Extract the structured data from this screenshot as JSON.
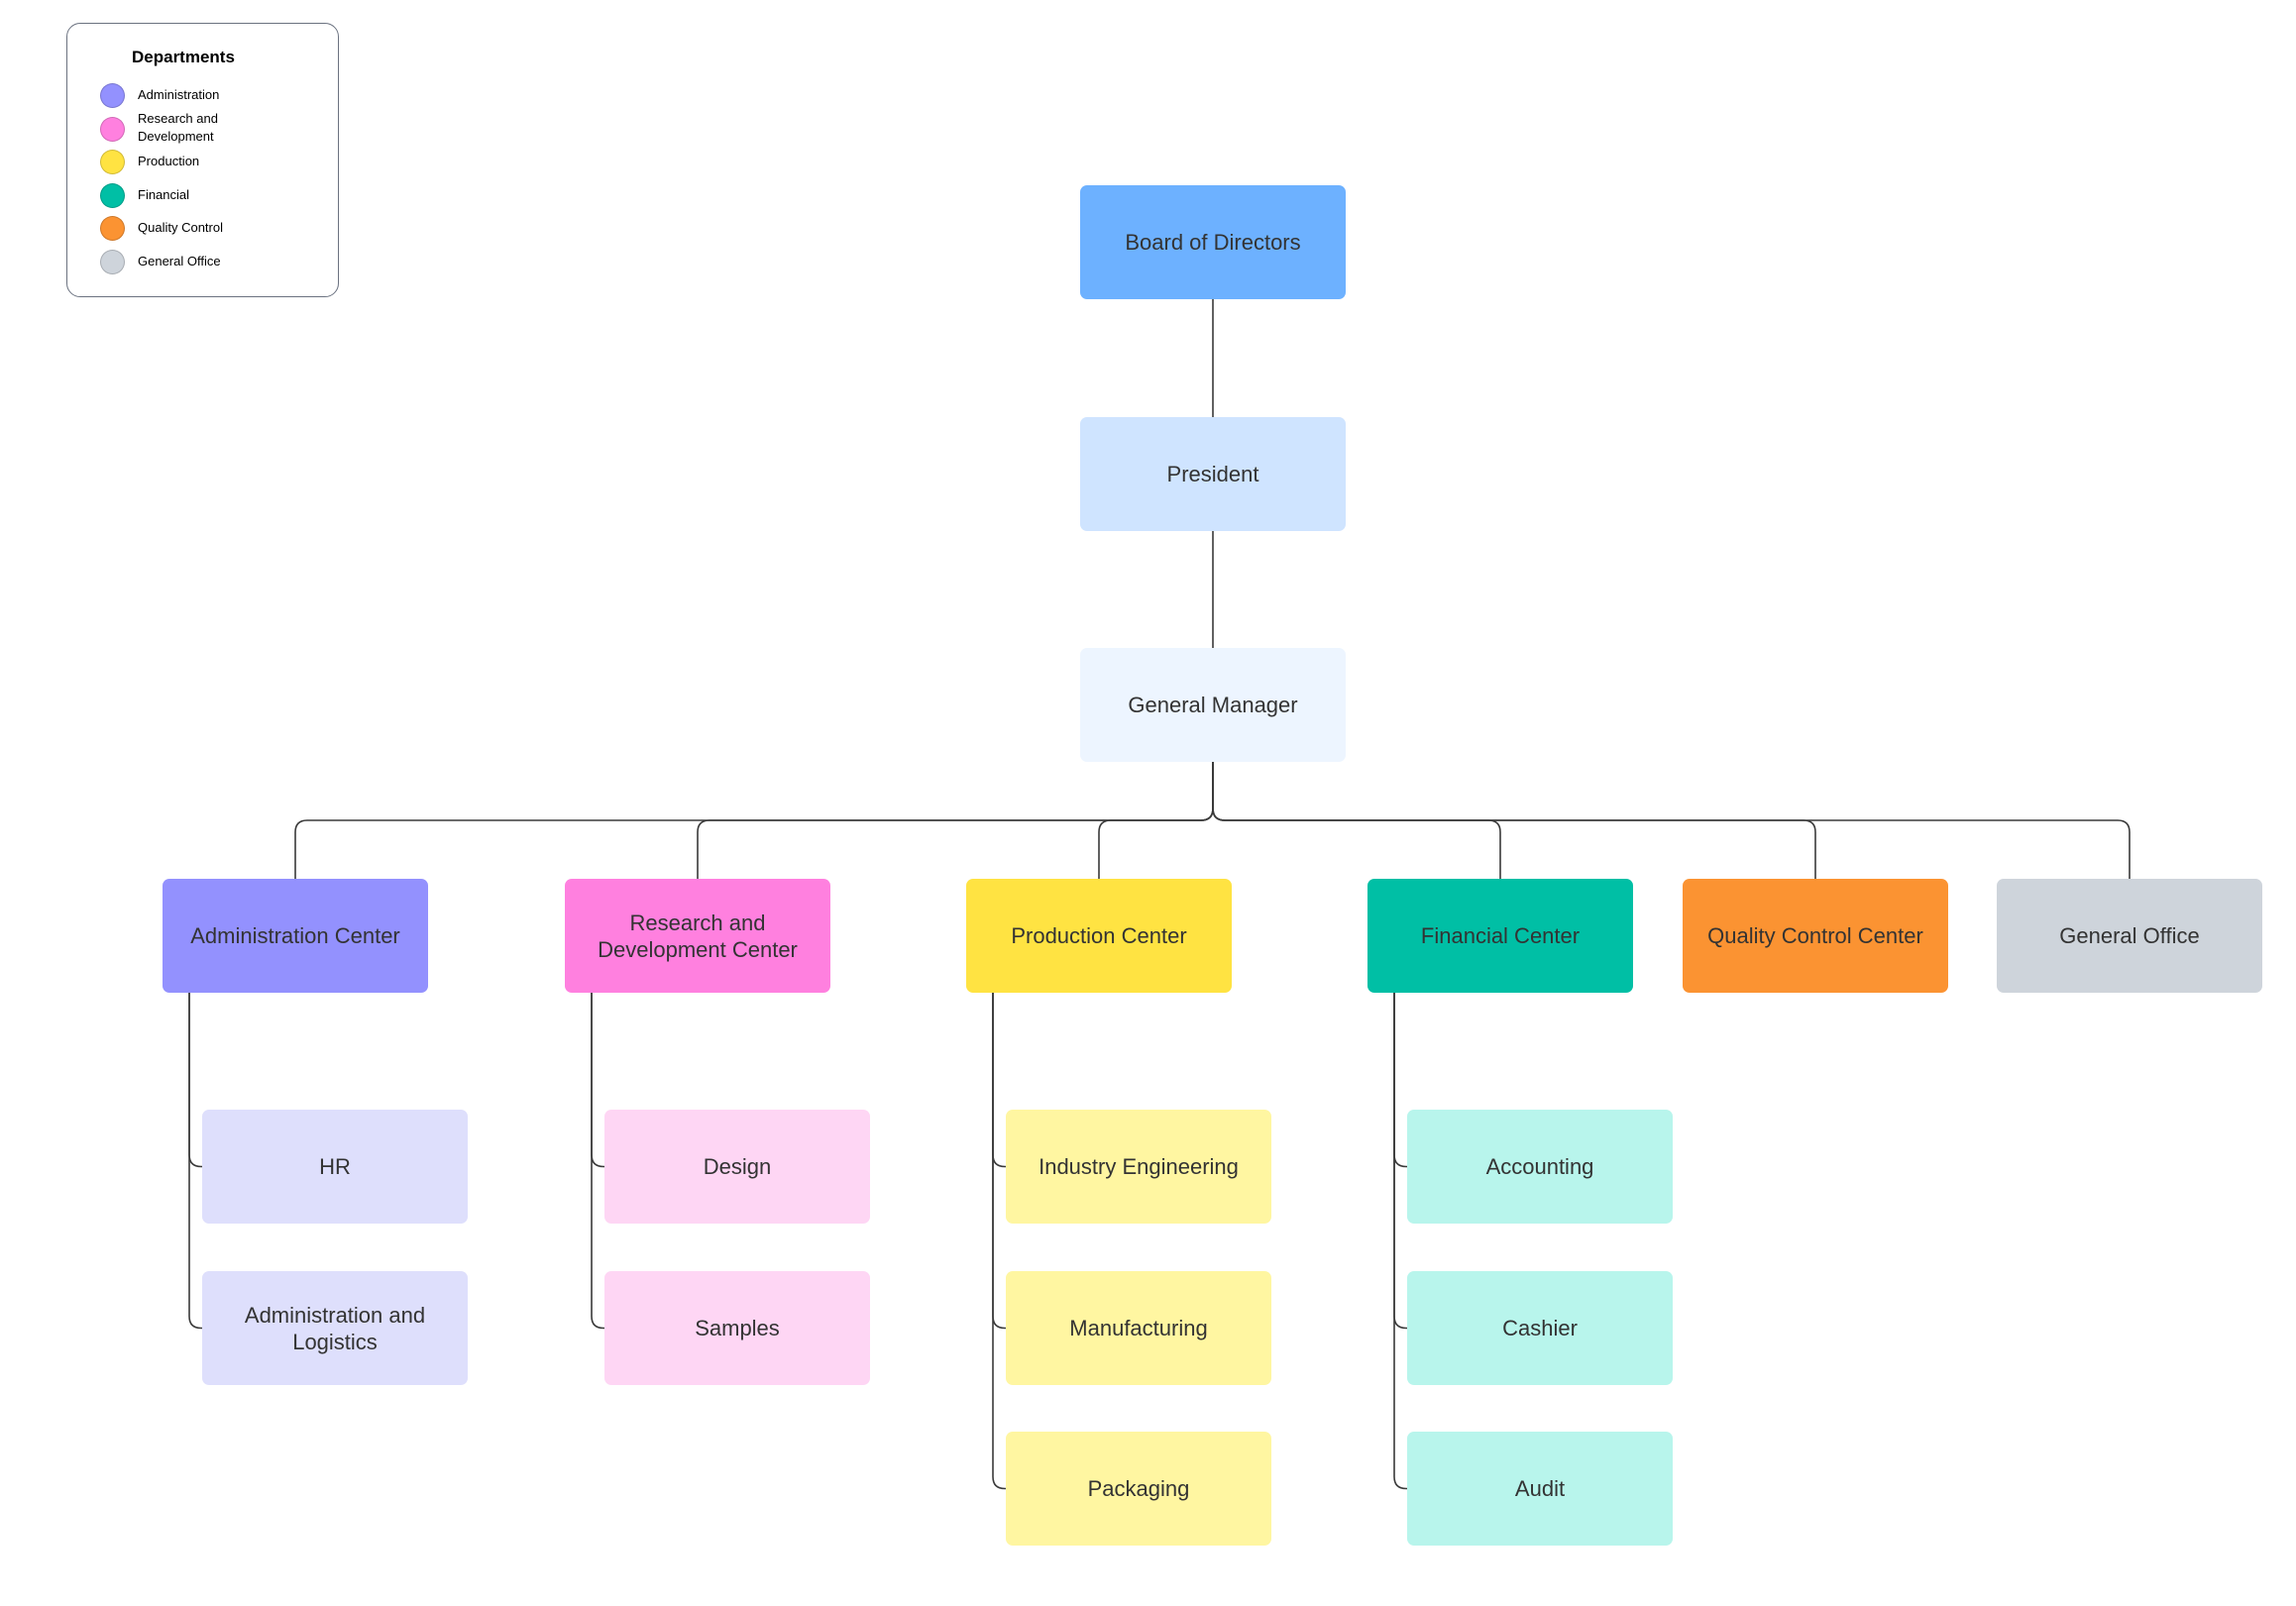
{
  "legend": {
    "title": "Departments",
    "items": [
      {
        "label": "Administration",
        "color": "#9391fe"
      },
      {
        "label": "Research and Development",
        "color": "#ff80df"
      },
      {
        "label": "Production",
        "color": "#ffe342"
      },
      {
        "label": "Financial",
        "color": "#00bfa5"
      },
      {
        "label": "Quality Control",
        "color": "#fb9332"
      },
      {
        "label": "General Office",
        "color": "#ced4db"
      }
    ]
  },
  "chain": [
    {
      "label": "Board of Directors",
      "color": "#6db1ff"
    },
    {
      "label": "President",
      "color": "#cfe4ff"
    },
    {
      "label": "General Manager",
      "color": "#edf5ff"
    }
  ],
  "departments": [
    {
      "label": "Administration Center",
      "color": "#9391fe",
      "child_color": "#dedffc",
      "children": [
        "HR",
        "Administration and Logistics"
      ]
    },
    {
      "label": "Research and Development Center",
      "color": "#ff80df",
      "child_color": "#fed6f4",
      "children": [
        "Design",
        "Samples"
      ]
    },
    {
      "label": "Production Center",
      "color": "#ffe342",
      "child_color": "#fff6a1",
      "children": [
        "Industry Engineering",
        "Manufacturing",
        "Packaging"
      ]
    },
    {
      "label": "Financial Center",
      "color": "#00bfa5",
      "child_color": "#b8f5ec",
      "children": [
        "Accounting",
        "Cashier",
        "Audit"
      ]
    },
    {
      "label": "Quality Control Center",
      "color": "#fb9332",
      "child_color": "#fde0c2",
      "children": []
    },
    {
      "label": "General Office",
      "color": "#ced4db",
      "child_color": "#eef1f4",
      "children": []
    }
  ]
}
